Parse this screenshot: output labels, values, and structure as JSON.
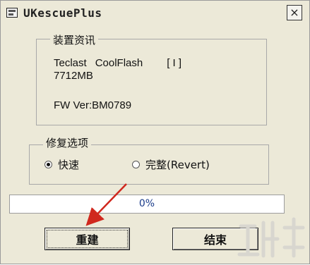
{
  "window": {
    "title": "UKescuePlus",
    "close_glyph": "×"
  },
  "device_info": {
    "group_label": "装置资讯",
    "vendor": "Teclast",
    "model": "CoolFlash",
    "index": "[ I ]",
    "capacity": "7712MB",
    "firmware": "FW Ver:BM0789"
  },
  "repair_options": {
    "group_label": "修复选项",
    "options": [
      {
        "label": "快速",
        "selected": true
      },
      {
        "label": "完整(Revert)",
        "selected": false
      }
    ]
  },
  "progress": {
    "value_text": "0%",
    "fraction": 0
  },
  "buttons": {
    "rebuild_label": "重建",
    "end_label": "结束"
  },
  "colors": {
    "arrow": "#d0281e",
    "progress_text": "#1a3c8a"
  }
}
